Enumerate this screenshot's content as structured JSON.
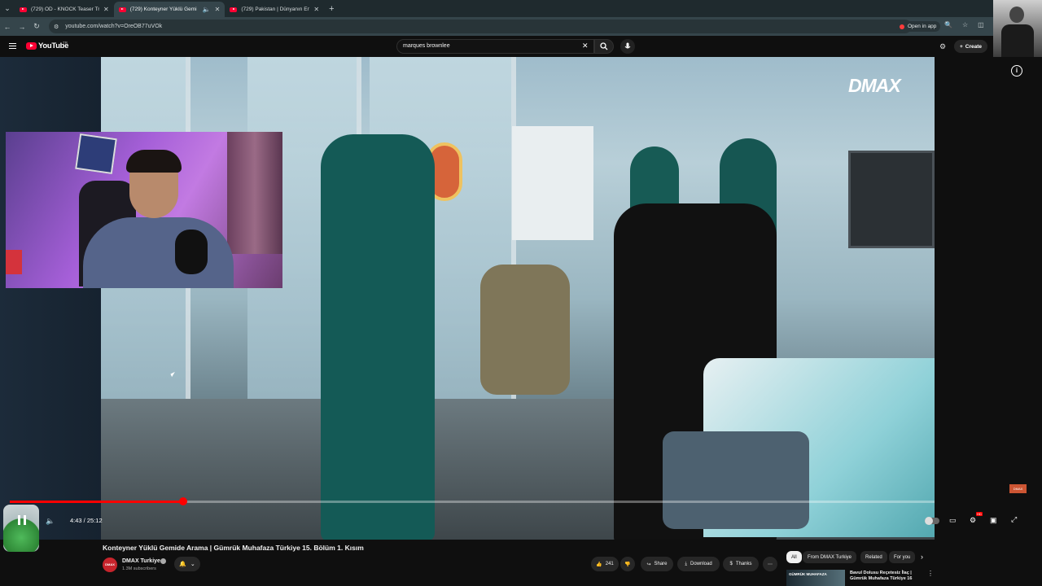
{
  "browser": {
    "tabs": [
      {
        "title": "(729) OD - KNOCK Teaser Traile",
        "active": false
      },
      {
        "title": "(729) Konteyner Yüklü Gemi",
        "active": true
      },
      {
        "title": "(729) Pakistan | Dünyanın En K",
        "active": false
      }
    ],
    "url": "youtube.com/watch?v=OreOB77uVOk",
    "open_in_app": "Open in app"
  },
  "youtube": {
    "logo": "YouTube",
    "country_code": "TR",
    "search_value": "marques brownlee",
    "create_label": "Create"
  },
  "player": {
    "time_current": "4:43",
    "time_total": "25:12",
    "time_display": "4:43 / 25:12",
    "progress_fraction": 0.1872,
    "watermark": "DMAX",
    "hd_badge": "HD",
    "corner_badge": "DMAX"
  },
  "video": {
    "title": "Konteyner Yüklü Gemide Arama | Gümrük Muhafaza Türkiye 15. Bölüm 1. Kısım",
    "channel": "DMAX Turkiye",
    "channel_avatar_text": "DMAX",
    "subscribers": "1.3M subscribers",
    "likes": "241",
    "share_label": "Share",
    "download_label": "Download",
    "thanks_label": "Thanks"
  },
  "chips": [
    "All",
    "From DMAX Turkiye",
    "Related",
    "For you"
  ],
  "recommendation": {
    "thumb_text": "GÜMRÜK MUHAFAZA",
    "title": "Bavul Dolusu Reçetesiz İlaç | Gümrük Muhafaza Türkiye 16"
  },
  "colors": {
    "accent": "#ff0000",
    "youtube_red": "#ff0033",
    "background": "#0f0f0f"
  }
}
